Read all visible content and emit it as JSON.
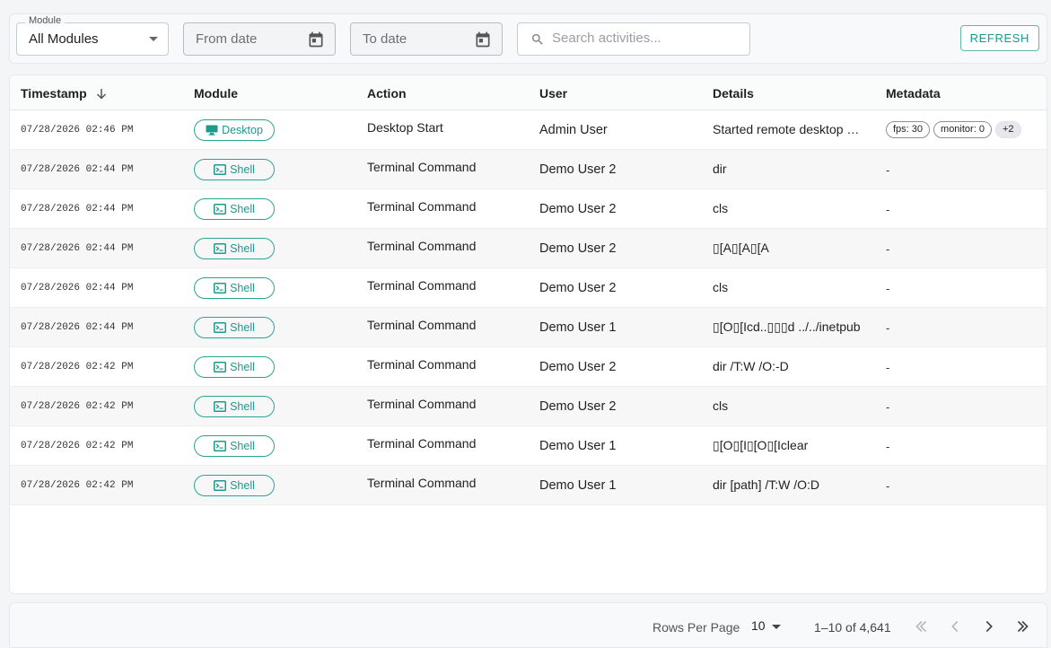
{
  "filters": {
    "module_label": "Module",
    "module_value": "All Modules",
    "from_placeholder": "From date",
    "to_placeholder": "To date",
    "search_placeholder": "Search activities...",
    "refresh_label": "REFRESH"
  },
  "table": {
    "headers": {
      "timestamp": "Timestamp",
      "module": "Module",
      "action": "Action",
      "user": "User",
      "details": "Details",
      "metadata": "Metadata"
    },
    "rows": [
      {
        "timestamp": "07/28/2026 02:46 PM",
        "module": "Desktop",
        "action": "Desktop Start",
        "user": "Admin User",
        "details": "Started remote desktop session",
        "metadata_chips": [
          "fps: 30",
          "monitor: 0",
          "+2"
        ]
      },
      {
        "timestamp": "07/28/2026 02:44 PM",
        "module": "Shell",
        "action": "Terminal Command",
        "user": "Demo User 2",
        "details": "dir",
        "metadata": "-"
      },
      {
        "timestamp": "07/28/2026 02:44 PM",
        "module": "Shell",
        "action": "Terminal Command",
        "user": "Demo User 2",
        "details": "cls",
        "metadata": "-"
      },
      {
        "timestamp": "07/28/2026 02:44 PM",
        "module": "Shell",
        "action": "Terminal Command",
        "user": "Demo User 2",
        "details": "▯[A▯[A▯[A",
        "metadata": "-"
      },
      {
        "timestamp": "07/28/2026 02:44 PM",
        "module": "Shell",
        "action": "Terminal Command",
        "user": "Demo User 2",
        "details": "cls",
        "metadata": "-"
      },
      {
        "timestamp": "07/28/2026 02:44 PM",
        "module": "Shell",
        "action": "Terminal Command",
        "user": "Demo User 1",
        "details": "▯[O▯[Icd..▯▯▯d ../../inetpub",
        "metadata": "-"
      },
      {
        "timestamp": "07/28/2026 02:42 PM",
        "module": "Shell",
        "action": "Terminal Command",
        "user": "Demo User 2",
        "details": "dir /T:W /O:-D",
        "metadata": "-"
      },
      {
        "timestamp": "07/28/2026 02:42 PM",
        "module": "Shell",
        "action": "Terminal Command",
        "user": "Demo User 2",
        "details": "cls",
        "metadata": "-"
      },
      {
        "timestamp": "07/28/2026 02:42 PM",
        "module": "Shell",
        "action": "Terminal Command",
        "user": "Demo User 1",
        "details": "▯[O▯[I▯[O▯[Iclear",
        "metadata": "-"
      },
      {
        "timestamp": "07/28/2026 02:42 PM",
        "module": "Shell",
        "action": "Terminal Command",
        "user": "Demo User 1",
        "details": "dir [path] /T:W /O:D",
        "metadata": "-"
      }
    ]
  },
  "pagination": {
    "rows_per_page_label": "Rows Per Page",
    "rows_per_page_value": "10",
    "range_text": "1–10 of 4,641"
  },
  "colors": {
    "accent": "#1c9a8a",
    "chip_border": "#2aa493"
  }
}
